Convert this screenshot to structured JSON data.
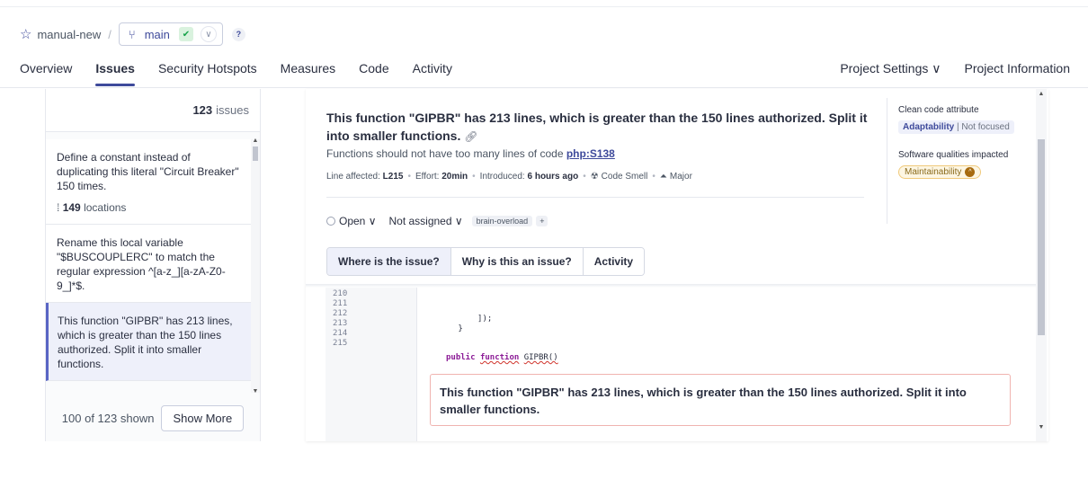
{
  "breadcrumb": {
    "project": "manual-new",
    "separator": "/",
    "branch": "main",
    "help": "?"
  },
  "nav": {
    "tabs": [
      "Overview",
      "Issues",
      "Security Hotspots",
      "Measures",
      "Code",
      "Activity"
    ],
    "active": "Issues",
    "right": [
      "Project Settings ∨",
      "Project Information"
    ]
  },
  "issues": {
    "count": "123",
    "count_suffix": "issues",
    "items": [
      {
        "text": "Define a constant instead of duplicating this literal \"Circuit Breaker\" 150 times.",
        "locations": "149",
        "locations_suffix": "locations"
      },
      {
        "text": "Rename this local variable \"$BUSCOUPLERC\" to match the regular expression ^[a-z_][a-zA-Z0-9_]*$."
      },
      {
        "text": "This function \"GIPBR\" has 213 lines, which is greater than the 150 lines authorized. Split it into smaller functions."
      }
    ],
    "footer_text": "100 of 123 shown",
    "show_more": "Show More"
  },
  "detail": {
    "title": "This function \"GIPBR\" has 213 lines, which is greater than the 150 lines authorized. Split it into smaller functions.",
    "rule_text": "Functions should not have too many lines of code",
    "rule_key": "php:S138",
    "meta": {
      "line_label": "Line affected:",
      "line_value": "L215",
      "effort_label": "Effort:",
      "effort_value": "20min",
      "introduced_label": "Introduced:",
      "introduced_value": "6 hours ago",
      "type": "Code Smell",
      "severity": "Major"
    },
    "status": "Open",
    "assignee": "Not assigned",
    "tag": "brain-overload",
    "tag_add": "+",
    "clean_code_label": "Clean code attribute",
    "clean_code_attr": "Adaptability",
    "clean_code_focus": "Not focused",
    "qualities_label": "Software qualities impacted",
    "quality": "Maintainability",
    "tabs": [
      "Where is the issue?",
      "Why is this an issue?",
      "Activity"
    ],
    "active_tab": "Where is the issue?"
  },
  "code": {
    "line_numbers": [
      "210",
      "211",
      "212",
      "213",
      "214",
      "215"
    ],
    "lines": [
      "",
      "",
      "            ]);",
      "        }",
      "",
      ""
    ],
    "line215_kw1": "public",
    "line215_kw2": "function",
    "line215_rest": "GIPBR()",
    "callout": "This function \"GIPBR\" has 213 lines, which is greater than the 150 lines authorized. Split it into smaller functions."
  },
  "colors": {
    "accent": "#3e4a9b",
    "selected_bg": "#eef0fa",
    "error_border": "#f0b4b0"
  }
}
